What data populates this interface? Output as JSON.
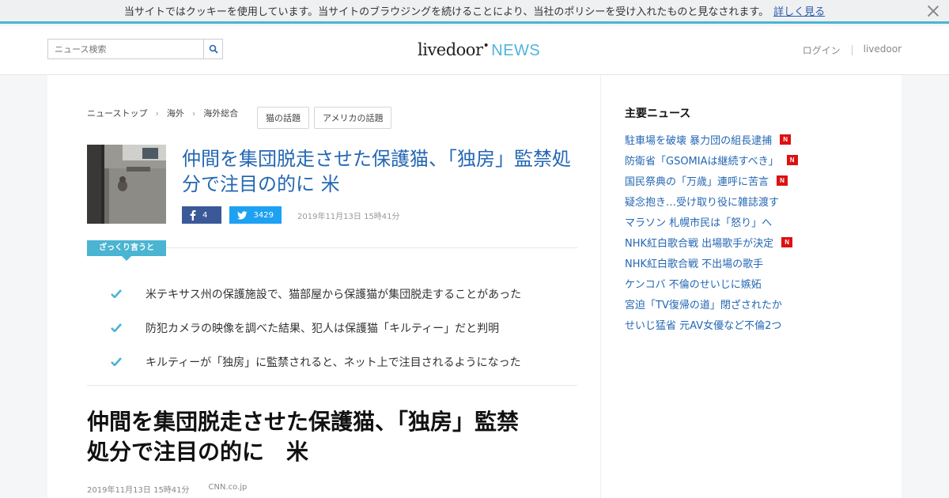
{
  "cookie": {
    "text": "当サイトではクッキーを使用しています。当サイトのブラウジングを続けることにより、当社のポリシーを受け入れたものと見なされます。",
    "link": "詳しく見る"
  },
  "header": {
    "search_placeholder": "ニュース検索",
    "logo_main": "livedoor",
    "logo_news": "NEWS",
    "login": "ログイン",
    "livedoor_link": "livedoor"
  },
  "breadcrumb": [
    "ニューストップ",
    "海外",
    "海外総合"
  ],
  "tags": [
    "猫の話題",
    "アメリカの話題"
  ],
  "article": {
    "headline": "仲間を集団脱走させた保護猫、「独房」監禁処分で注目の的に 米",
    "fb_count": "4",
    "tw_count": "3429",
    "date_top": "2019年11月13日 15時41分",
    "zakkuri_label": "ざっくり言うと",
    "summary": [
      "米テキサス州の保護施設で、猫部屋から保護猫が集団脱走することがあった",
      "防犯カメラの映像を調べた結果、犯人は保護猫「キルティー」だと判明",
      "キルティーが「独房」に監禁されると、ネット上で注目されるようになった"
    ],
    "title_line1": "仲間を集団脱走させた保護猫、「独房」監禁",
    "title_line2": "処分で注目の的に　米",
    "date_bottom": "2019年11月13日 15時41分",
    "source": "CNN.co.jp"
  },
  "sidebar": {
    "title": "主要ニュース",
    "new_badge": "N",
    "items": [
      {
        "label": "駐車場を破壊 暴力団の組長逮捕",
        "is_new": true
      },
      {
        "label": "防衛省「GSOMIAは継続すべき」",
        "is_new": true
      },
      {
        "label": "国民祭典の「万歳」連呼に苦言",
        "is_new": true
      },
      {
        "label": "疑念抱き…受け取り役に雑誌渡す",
        "is_new": false
      },
      {
        "label": "マラソン 札幌市民は「怒り」へ",
        "is_new": false
      },
      {
        "label": "NHK紅白歌合戦 出場歌手が決定",
        "is_new": true
      },
      {
        "label": "NHK紅白歌合戦 不出場の歌手",
        "is_new": false
      },
      {
        "label": "ケンコバ 不倫のせいじに嫉妬",
        "is_new": false
      },
      {
        "label": "宮迫「TV復帰の道」閉ざされたか",
        "is_new": false
      },
      {
        "label": "せいじ猛省 元AV女優など不倫2つ",
        "is_new": false
      }
    ]
  },
  "colors": {
    "accent": "#4bb4d2",
    "link": "#2467b3",
    "facebook": "#3b5998",
    "twitter": "#1da1f2",
    "new_badge": "#dd1111"
  }
}
